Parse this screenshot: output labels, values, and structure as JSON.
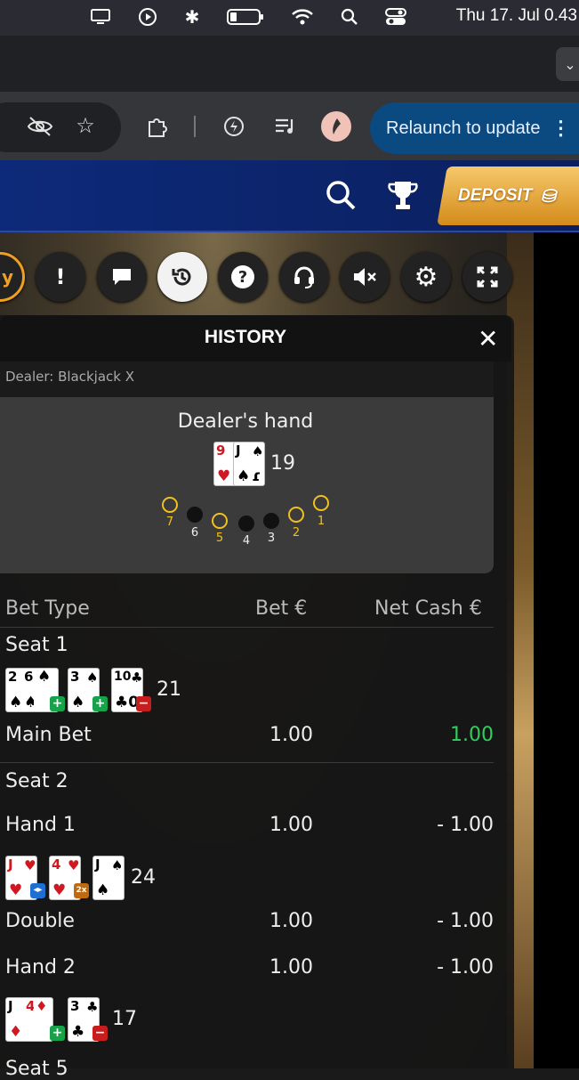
{
  "system_menubar": {
    "clock": "Thu 17. Jul  0.43",
    "icons": [
      "display-icon",
      "play-icon",
      "bluetooth-icon",
      "battery-icon",
      "wifi-icon",
      "search-icon",
      "control-center-icon"
    ]
  },
  "browser": {
    "relaunch_label": "Relaunch to update",
    "toolbar_icons": [
      "eye-off-icon",
      "star-icon",
      "extensions-icon",
      "leaf-icon",
      "media-icon",
      "profile-avatar",
      "more-icon"
    ]
  },
  "site": {
    "deposit_label": "DEPOSIT",
    "header_icons": [
      "search-icon",
      "trophy-icon",
      "coins-icon"
    ]
  },
  "game_controls": [
    "tips-icon",
    "chat-icon",
    "history-icon",
    "help-icon",
    "support-icon",
    "mute-icon",
    "settings-icon",
    "fullscreen-icon"
  ],
  "history": {
    "title": "HISTORY",
    "dealer_label": "Dealer: Blackjack X",
    "dealer_hand_title": "Dealer's hand",
    "dealer_cards": [
      {
        "rank": "9",
        "suit": "♥"
      },
      {
        "rank": "J",
        "suit": "♠"
      }
    ],
    "dealer_total": "19",
    "spots": [
      {
        "label": "7",
        "occupied": true
      },
      {
        "label": "6",
        "occupied": false
      },
      {
        "label": "5",
        "occupied": true
      },
      {
        "label": "4",
        "occupied": false
      },
      {
        "label": "3",
        "occupied": false
      },
      {
        "label": "2",
        "occupied": true
      },
      {
        "label": "1",
        "occupied": true
      }
    ],
    "columns": {
      "bet_type": "Bet Type",
      "bet": "Bet €",
      "net_cash": "Net Cash €"
    },
    "seat1": {
      "label": "Seat 1",
      "cards": [
        {
          "rank": "2",
          "suit": "♠",
          "action": "+"
        },
        {
          "rank": "6",
          "suit": "♠",
          "action": ""
        },
        {
          "rank": "3",
          "suit": "♠",
          "action": "+"
        },
        {
          "rank": "10",
          "suit": "♣",
          "action": "−"
        }
      ],
      "total": "21",
      "rows": [
        {
          "type": "Main Bet",
          "bet": "1.00",
          "net": "1.00"
        }
      ]
    },
    "seat2": {
      "label": "Seat 2",
      "hand1": {
        "label": "Hand 1",
        "bet": "1.00",
        "net": "- 1.00",
        "cards": [
          {
            "rank": "J",
            "suit": "♥",
            "action": "split"
          },
          {
            "rank": "4",
            "suit": "♥",
            "action": "2x"
          },
          {
            "rank": "J",
            "suit": "♠",
            "action": ""
          }
        ],
        "total": "24",
        "double": {
          "type": "Double",
          "bet": "1.00",
          "net": "- 1.00"
        }
      },
      "hand2": {
        "label": "Hand 2",
        "bet": "1.00",
        "net": "- 1.00",
        "cards": [
          {
            "rank": "J",
            "suit": "♦",
            "action": "+"
          },
          {
            "rank": "4",
            "suit": "♦",
            "action": ""
          },
          {
            "rank": "3",
            "suit": "♣",
            "action": "−"
          }
        ],
        "total": "17"
      }
    },
    "seat5_label": "Seat 5"
  },
  "colors": {
    "win": "#2fcf5a",
    "relaunch_bg": "#0b4a80",
    "site_header": "#0d2a7a",
    "deposit_gold": "#e8a83a"
  }
}
